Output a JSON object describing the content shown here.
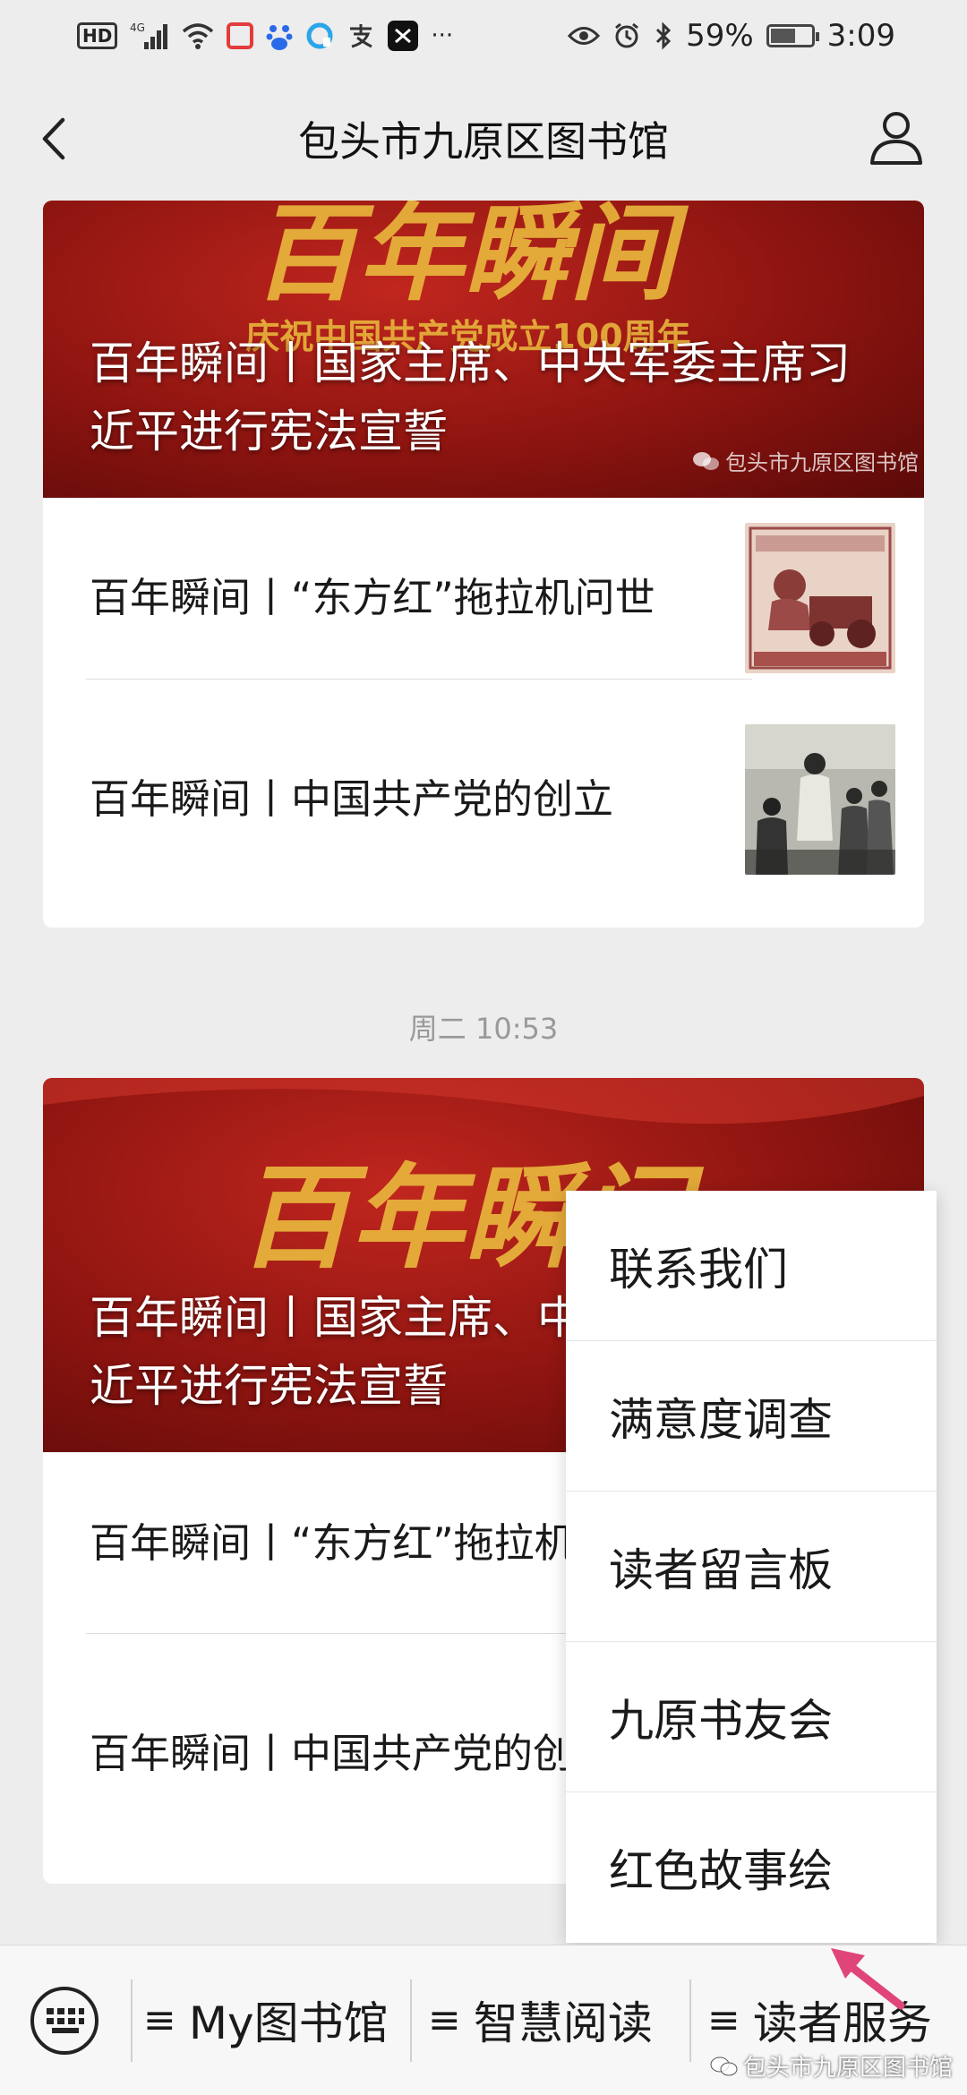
{
  "status_bar": {
    "hd": "HD",
    "network": "4G",
    "battery_percent": "59%",
    "battery_level": 0.59,
    "time": "3:09",
    "more": "···",
    "icons": [
      "hd-icon",
      "signal-icon",
      "wifi-icon",
      "app-red-icon",
      "baidu-icon",
      "browser-icon",
      "alipay-icon",
      "capcut-icon",
      "eye-icon",
      "alarm-icon",
      "bluetooth-icon",
      "battery-icon"
    ]
  },
  "nav": {
    "title": "包头市九原区图书馆",
    "icons": [
      "back-chevron-icon",
      "user-profile-icon"
    ]
  },
  "messages": [
    {
      "banner_title": "百年瞬间丨国家主席、中央军委主席习近平进行宪法宣誓",
      "banner_art": "百年瞬间",
      "banner_subtitle": "庆祝中国共产党成立100周年",
      "watermark": "包头市九原区图书馆",
      "items": [
        {
          "title": "百年瞬间丨“东方红”拖拉机问世",
          "thumb": "banknote-tractor-thumbnail"
        },
        {
          "title": "百年瞬间丨中国共产党的创立",
          "thumb": "founding-meeting-thumbnail"
        }
      ]
    },
    {
      "timestamp": "周二 10:53",
      "banner_title": "百年瞬间丨国家主席、中央军委主席习近平进行宪法宣誓",
      "banner_art": "百年瞬间",
      "items": [
        {
          "title": "百年瞬间丨“东方红”拖拉机问世"
        },
        {
          "title": "百年瞬间丨中国共产党的创立"
        }
      ]
    }
  ],
  "popup_menu": {
    "items": [
      "联系我们",
      "满意度调查",
      "读者留言板",
      "九原书友会",
      "红色故事绘"
    ]
  },
  "bottom_menu": {
    "keyboard_icon": "keyboard-icon",
    "items": [
      {
        "label": "My图书馆",
        "icon": "≡"
      },
      {
        "label": "智慧阅读",
        "icon": "≡"
      },
      {
        "label": "读者服务",
        "icon": "≡"
      }
    ],
    "watermark": "包头市九原区图书馆"
  },
  "colors": {
    "banner_red": "#a01a14",
    "gold_text": "#e8b53c",
    "arrow_pink": "#e0457a",
    "background": "#ededed"
  }
}
